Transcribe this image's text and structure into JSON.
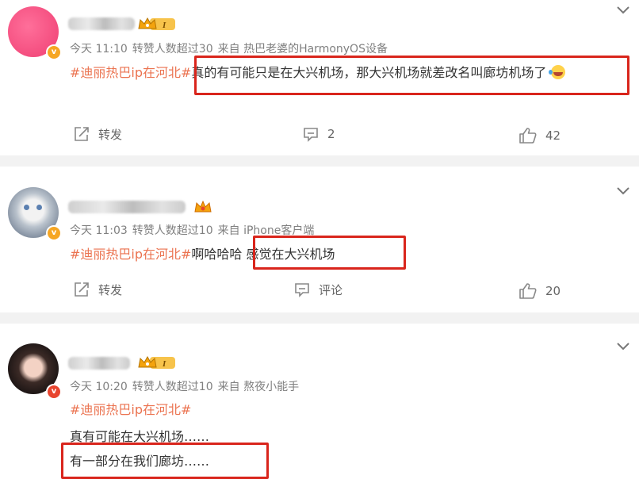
{
  "posts": [
    {
      "time": "今天 11:10",
      "reposts": "转赞人数超过30",
      "source": "来自 热巴老婆的HarmonyOS设备",
      "topic": "#迪丽热巴ip在河北#",
      "text": "真的有可能只是在大兴机场，那大兴机场就差改名叫廊坊机场了",
      "repost_label": "转发",
      "comment_label": "2",
      "like_count": "42",
      "badge": "I"
    },
    {
      "time": "今天 11:03",
      "reposts": "转赞人数超过10",
      "source": "来自 iPhone客户端",
      "topic": "#迪丽热巴ip在河北#",
      "text_a": "啊哈哈哈",
      "text_b": "感觉在大兴机场",
      "repost_label": "转发",
      "comment_label": "评论",
      "like_count": "20"
    },
    {
      "time": "今天 10:20",
      "reposts": "转赞人数超过10",
      "source": "来自 熬夜小能手",
      "topic": "#迪丽热巴ip在河北#",
      "line1": "真有可能在大兴机场……",
      "line2": "有一部分在我们廊坊……",
      "badge": "I"
    }
  ],
  "colors": {
    "topic": "#eb7350",
    "highlight_box": "#d9251c",
    "separator": "#f2f2f2"
  }
}
